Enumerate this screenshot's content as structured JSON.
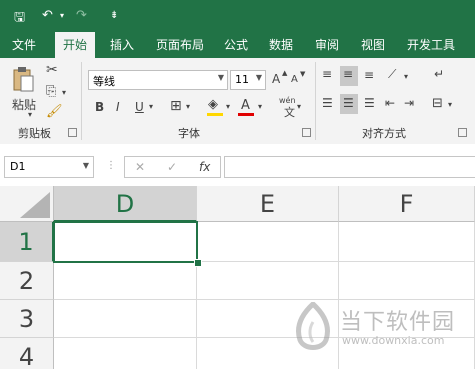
{
  "quick_access": {
    "save": "🖫",
    "undo": "↶",
    "redo": "↷",
    "customize": "⇟"
  },
  "tabs": [
    "文件",
    "开始",
    "插入",
    "页面布局",
    "公式",
    "数据",
    "审阅",
    "视图",
    "开发工具"
  ],
  "clipboard": {
    "paste_label": "粘贴",
    "group_label": "剪贴板"
  },
  "font": {
    "name": "等线",
    "size": "11",
    "group_label": "字体",
    "bold": "B",
    "italic": "I",
    "underline": "U",
    "grow": "A",
    "shrink": "A",
    "phonetic": "wén"
  },
  "alignment": {
    "group_label": "对齐方式"
  },
  "formula_bar": {
    "name_box": "D1",
    "fx": "fx",
    "cancel": "✕",
    "enter": "✓",
    "value": ""
  },
  "columns": [
    "D",
    "E",
    "F"
  ],
  "rows": [
    "1",
    "2",
    "3",
    "4"
  ],
  "watermark": {
    "text": "当下软件园",
    "url": "www.downxia.com"
  },
  "colors": {
    "accent": "#217346",
    "fill_color": "#ffd700",
    "font_color": "#e00000"
  }
}
